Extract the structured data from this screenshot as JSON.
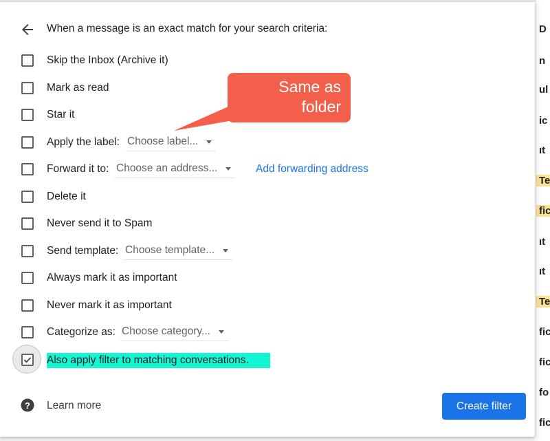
{
  "header": {
    "title": "When a message is an exact match for your search criteria:"
  },
  "options": {
    "skip_inbox": "Skip the Inbox (Archive it)",
    "mark_read": "Mark as read",
    "star": "Star it",
    "apply_label": "Apply the label:",
    "label_dropdown": "Choose label...",
    "forward": "Forward it to:",
    "forward_dropdown": "Choose an address...",
    "add_forwarding": "Add forwarding address",
    "delete": "Delete it",
    "never_spam": "Never send it to Spam",
    "send_template": "Send template:",
    "template_dropdown": "Choose template...",
    "always_important": "Always mark it as important",
    "never_important": "Never mark it as important",
    "categorize": "Categorize as:",
    "category_dropdown": "Choose category...",
    "also_apply": "Also apply filter to matching conversations."
  },
  "annotation": {
    "text": "Same as\nfolder",
    "color": "#f45f4c"
  },
  "footer": {
    "learn_more": "Learn more",
    "create_filter": "Create filter"
  },
  "background_fragments": [
    "D",
    "n",
    "ul",
    "ic",
    "ıt",
    "Te",
    "fic",
    "ıt",
    "ıt",
    "Te",
    "fic",
    "fic",
    "fo",
    "fic"
  ],
  "colors": {
    "accent": "#1a73e8",
    "highlight": "#14f5d4"
  },
  "icons": {
    "back": "arrow-back-icon",
    "help": "help-circle-icon",
    "check": "check-icon"
  }
}
